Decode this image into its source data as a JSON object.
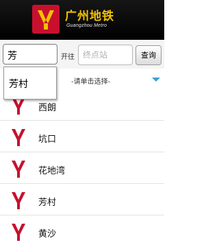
{
  "header": {
    "title": "广州地铁",
    "subtitle": "Guangzhou Metro",
    "logo_icon": "metro-y-logo",
    "brand_color": "#f2c200",
    "logo_color": "#c8102e"
  },
  "search": {
    "from_value": "芳",
    "to_label": "开往",
    "to_placeholder": "终点站",
    "query_label": "查询"
  },
  "suggestions": [
    "芳村"
  ],
  "prompt": "-请单击选择-",
  "stations": [
    {
      "name": "西朗",
      "icon": "metro-y-icon"
    },
    {
      "name": "坑口",
      "icon": "metro-y-icon"
    },
    {
      "name": "花地湾",
      "icon": "metro-y-icon"
    },
    {
      "name": "芳村",
      "icon": "metro-y-icon"
    },
    {
      "name": "黄沙",
      "icon": "metro-y-icon"
    }
  ],
  "accent_color": "#3aa0d8",
  "icon_color": "#c8102e"
}
